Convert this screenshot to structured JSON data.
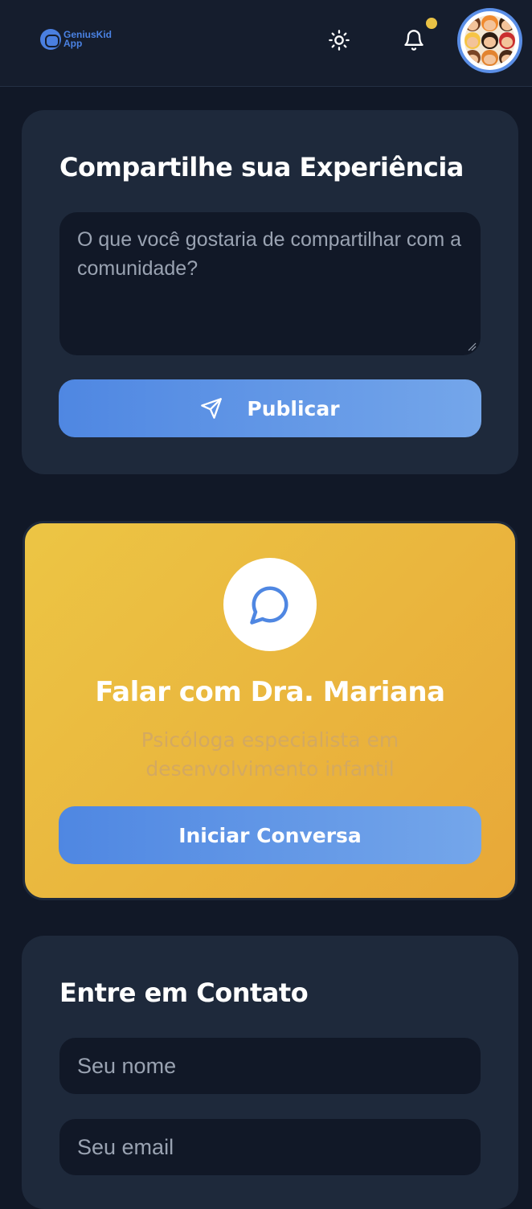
{
  "header": {
    "logo_text": "GeniusKid App",
    "icons": [
      "sun-icon",
      "bell-icon"
    ],
    "has_notification": true,
    "notification_color": "#e9c245"
  },
  "share": {
    "title": "Compartilhe sua Experiência",
    "textarea_placeholder": "O que você gostaria de compartilhar com a comunidade?",
    "publish_label": "Publicar"
  },
  "specialist": {
    "title": "Falar com Dra. Mariana",
    "subtitle": "Psicóloga especialista em desenvolvimento infantil",
    "button_label": "Iniciar Conversa"
  },
  "contact": {
    "title": "Entre em Contato",
    "name_placeholder": "Seu nome",
    "email_placeholder": "Seu email"
  },
  "colors": {
    "background": "#111827",
    "card": "#1e293b",
    "accent_blue": "#4f87e2",
    "accent_yellow": "#ecc544"
  }
}
